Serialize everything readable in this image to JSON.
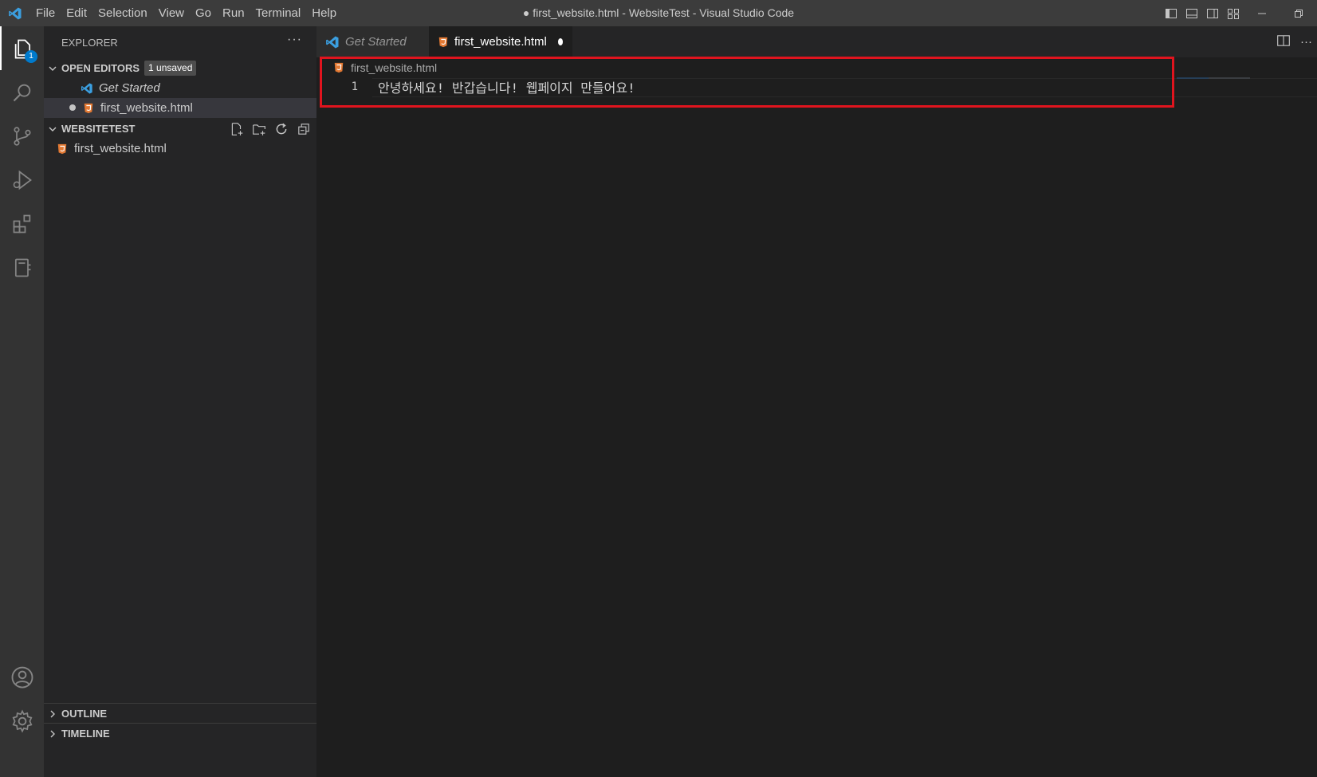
{
  "titlebar": {
    "menu": [
      "File",
      "Edit",
      "Selection",
      "View",
      "Go",
      "Run",
      "Terminal",
      "Help"
    ],
    "window_title": "● first_website.html - WebsiteTest - Visual Studio Code"
  },
  "activitybar": {
    "explorer_badge": "1"
  },
  "sidebar": {
    "header": "EXPLORER",
    "open_editors": {
      "title": "OPEN EDITORS",
      "badge": "1 unsaved",
      "items": [
        {
          "label": "Get Started",
          "icon": "vscode-logo-icon"
        },
        {
          "label": "first_website.html",
          "icon": "html5-icon",
          "dirty": true
        }
      ]
    },
    "folder": {
      "title": "WEBSITETEST",
      "files": [
        {
          "label": "first_website.html",
          "icon": "html5-icon"
        }
      ]
    },
    "outline": "OUTLINE",
    "timeline": "TIMELINE"
  },
  "editor": {
    "tabs": [
      {
        "label": "Get Started",
        "active": false
      },
      {
        "label": "first_website.html",
        "active": true,
        "dirty": true
      }
    ],
    "breadcrumb": "first_website.html",
    "lines": [
      {
        "number": "1",
        "text": "안녕하세요! 반갑습니다! 웹페이지 만들어요!"
      }
    ]
  },
  "colors": {
    "accent": "#007acc",
    "highlight_box": "#e0141e",
    "html_icon": "#e37933"
  }
}
